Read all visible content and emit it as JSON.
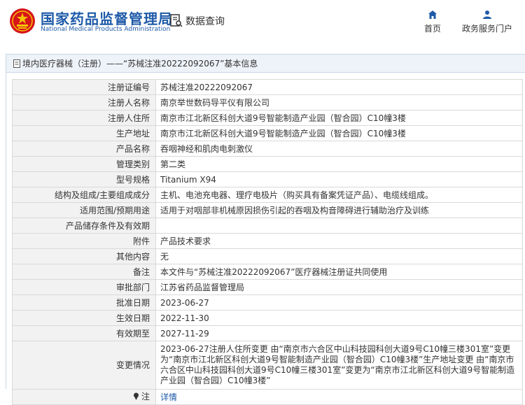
{
  "header": {
    "brand_cn": "国家药品监督管理局",
    "brand_en": "National Medical Products Administration",
    "query_label": "数据查询",
    "nav": [
      {
        "label": "首页",
        "icon": "home-icon"
      },
      {
        "label": "政务服务门户",
        "icon": "user-icon"
      }
    ]
  },
  "panel": {
    "title": "境内医疗器械（注册）——“苏械注准20222092067”基本信息"
  },
  "rows": [
    {
      "label": "注册证编号",
      "value": "苏械注准20222092067"
    },
    {
      "label": "注册人名称",
      "value": "南京举世数码导平仪有限公司"
    },
    {
      "label": "注册人住所",
      "value": "南京市江北新区科创大道9号智能制造产业园（智合园）C10幢3楼"
    },
    {
      "label": "生产地址",
      "value": "南京市江北新区科创大道9号智能制造产业园（智合园）C10幢3楼"
    },
    {
      "label": "产品名称",
      "value": "吞咽神经和肌肉电刺激仪"
    },
    {
      "label": "管理类别",
      "value": "第二类"
    },
    {
      "label": "型号规格",
      "value": "Titanium X94"
    },
    {
      "label": "结构及组成/主要组成成分",
      "value": "主机、电池充电器、理疗电极片（购买具有备案凭证产品）、电缆线组成。"
    },
    {
      "label": "适用范围/预期用途",
      "value": "适用于对咽部非机械原因损伤引起的吞咽及构音障碍进行辅助治疗及训练"
    },
    {
      "label": "产品储存条件及有效期",
      "value": ""
    },
    {
      "label": "附件",
      "value": "产品技术要求"
    },
    {
      "label": "其他内容",
      "value": "无"
    },
    {
      "label": "备注",
      "value": "本文件与“苏械注准20222092067”医疗器械注册证共同使用"
    },
    {
      "label": "审批部门",
      "value": "江苏省药品监督管理局"
    },
    {
      "label": "批准日期",
      "value": "2023-06-27"
    },
    {
      "label": "生效日期",
      "value": "2022-11-30"
    },
    {
      "label": "有效期至",
      "value": "2027-11-29"
    },
    {
      "label": "变更情况",
      "value": "2023-06-27注册人住所变更 由“南京市六合区中山科技园科创大道9号C10幢三楼301室”变更为“南京市江北新区科创大道9号智能制造产业园（智合园）C10幢3楼”生产地址变更 由“南京市六合区中山科技园科创大道9号C10幢三楼301室”变更为“南京市江北新区科创大道9号智能制造产业园（智合园）C10幢3楼”"
    }
  ],
  "note": {
    "label": "注",
    "link": "详情"
  },
  "colors": {
    "brand": "#1e5aa8",
    "logo_red": "#d7141a",
    "logo_gold": "#f5c400"
  }
}
